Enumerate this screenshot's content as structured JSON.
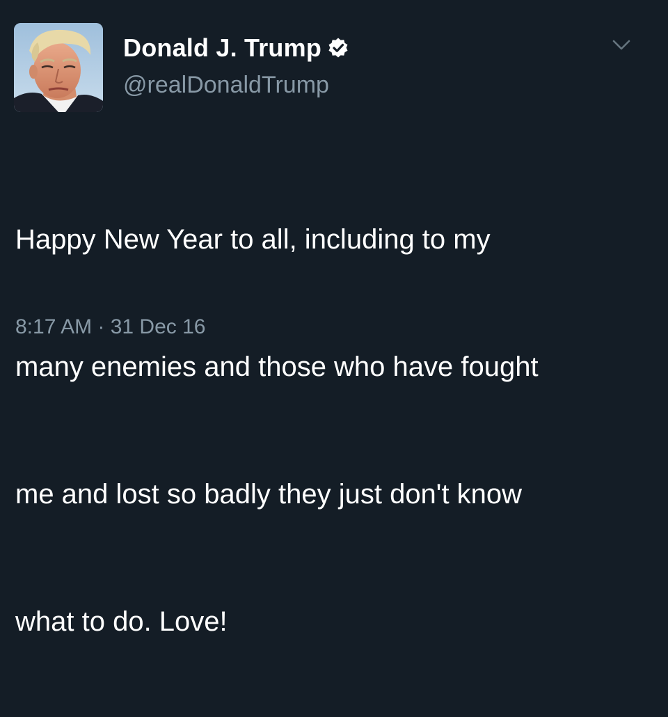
{
  "tweet": {
    "display_name": "Donald J. Trump",
    "handle": "@realDonaldTrump",
    "verified_icon": "verified-badge-icon",
    "menu_icon": "chevron-down-icon",
    "text_lines": [
      "Happy New Year to all, including to my",
      "many enemies and those who have fought",
      "me and lost so badly they just don't know",
      "what to do. Love!"
    ],
    "timestamp": "8:17 AM · 31 Dec 16"
  },
  "colors": {
    "background": "#141d26",
    "name_text": "#ffffff",
    "secondary_text": "#8899a6",
    "verified_badge": "#ffffff"
  }
}
